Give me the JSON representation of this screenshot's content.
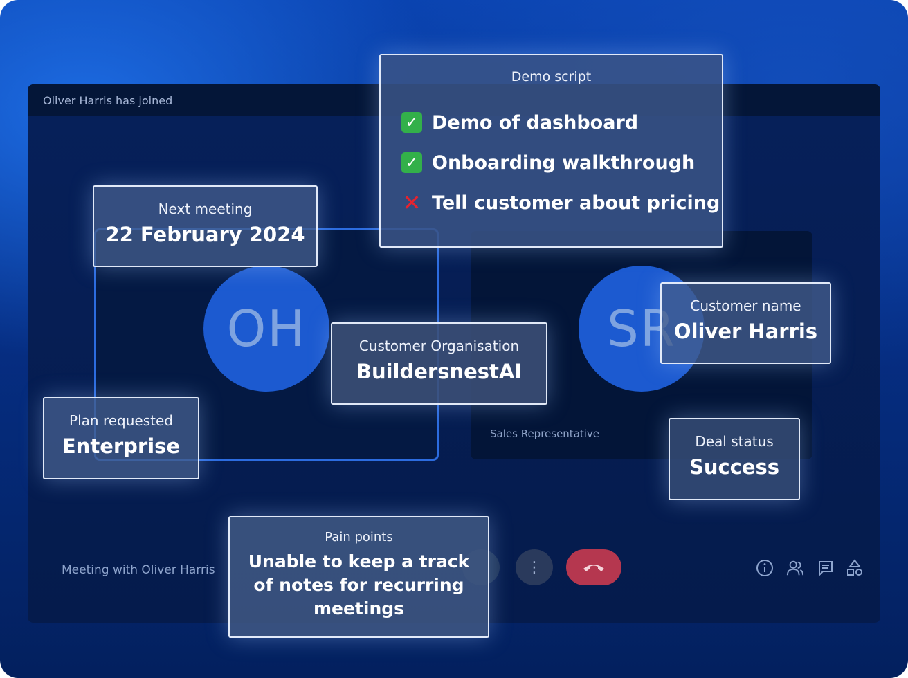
{
  "meeting": {
    "join_notice": "Oliver Harris has joined",
    "title": "Meeting with Oliver Harris",
    "participants": [
      {
        "initials": "OH",
        "role": ""
      },
      {
        "initials": "SR",
        "role": "Sales Representative"
      }
    ]
  },
  "controls": {
    "more_icon": "more-vertical-icon",
    "hangup_icon": "phone-hangup-icon",
    "tray_icons": [
      "info-icon",
      "people-icon",
      "chat-icon",
      "activities-icon"
    ]
  },
  "cards": {
    "demo_script": {
      "label": "Demo script",
      "items": [
        {
          "status": "done",
          "text": "Demo of dashboard"
        },
        {
          "status": "done",
          "text": "Onboarding walkthrough"
        },
        {
          "status": "not-done",
          "text": "Tell customer about pricing"
        }
      ]
    },
    "next_meeting": {
      "label": "Next meeting",
      "value": "22 February 2024"
    },
    "customer_org": {
      "label": "Customer Organisation",
      "value": "BuildersnestAI"
    },
    "customer_name": {
      "label": "Customer name",
      "value": "Oliver Harris"
    },
    "plan_requested": {
      "label": "Plan requested",
      "value": "Enterprise"
    },
    "deal_status": {
      "label": "Deal status",
      "value": "Success"
    },
    "pain_points": {
      "label": "Pain points",
      "value": "Unable to keep a track of notes for recurring meetings"
    }
  },
  "colors": {
    "background": "#062f86",
    "accent": "#2c6ce0",
    "hangup": "#b5374f",
    "check": "#33b04a",
    "cross": "#e5232f"
  }
}
